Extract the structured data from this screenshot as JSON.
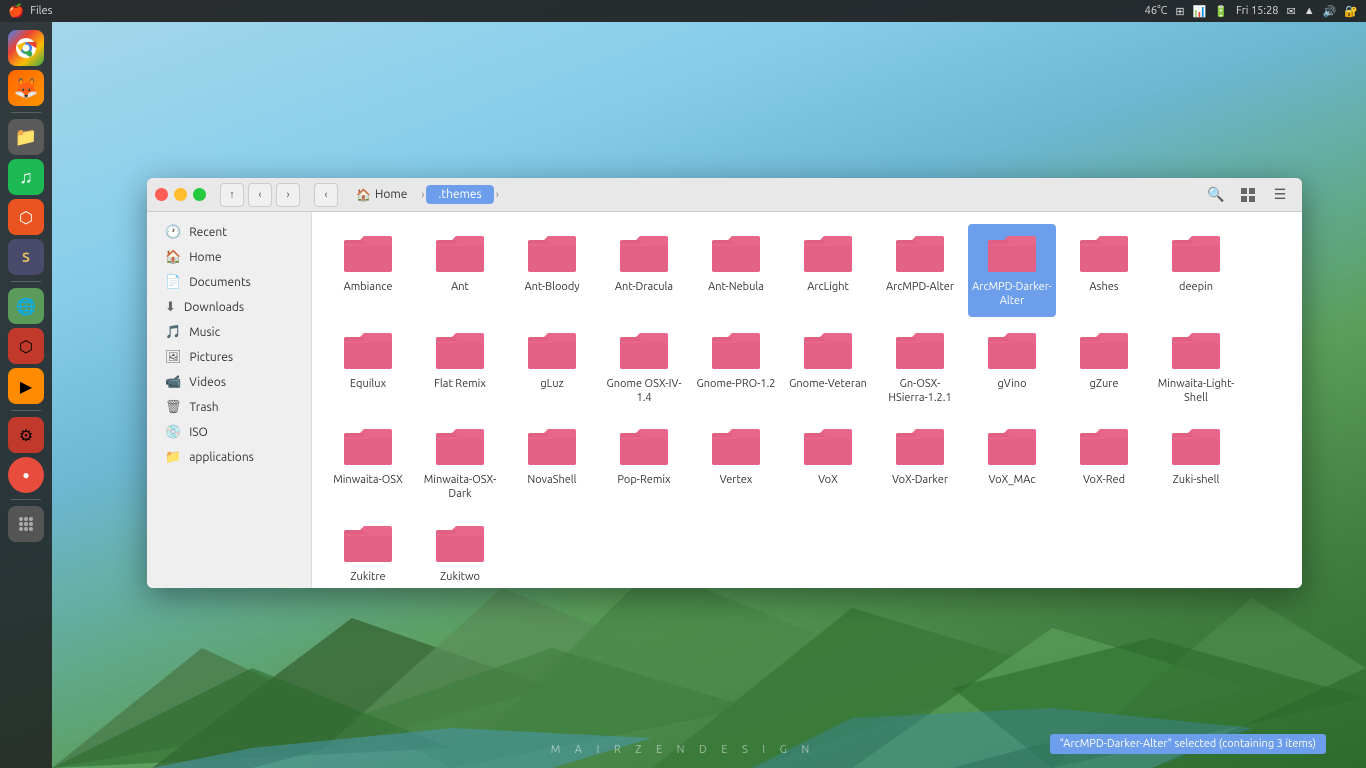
{
  "taskbar": {
    "apple": "🍎",
    "app_name": "Files",
    "system_info": "46°C",
    "datetime": "Fri 15:28",
    "icons": [
      "⊞",
      "📊",
      "🔋",
      "🔊",
      "🔐"
    ]
  },
  "dock": {
    "items": [
      {
        "name": "chrome",
        "label": "Chrome",
        "icon": "●"
      },
      {
        "name": "firefox",
        "label": "Firefox",
        "icon": "●"
      },
      {
        "name": "files",
        "label": "Files",
        "icon": "●"
      },
      {
        "name": "spotify",
        "label": "Spotify",
        "icon": "●"
      },
      {
        "name": "ubuntu",
        "label": "Ubuntu",
        "icon": "●"
      },
      {
        "name": "sublimetext",
        "label": "Sublime Text",
        "icon": "●"
      },
      {
        "name": "vpn",
        "label": "VPN",
        "icon": "●"
      },
      {
        "name": "hexagon",
        "label": "App",
        "icon": "●"
      },
      {
        "name": "vlc",
        "label": "VLC",
        "icon": "●"
      },
      {
        "name": "settings",
        "label": "Settings",
        "icon": "●"
      },
      {
        "name": "dots",
        "label": "App Grid",
        "icon": "●"
      }
    ]
  },
  "window": {
    "title": "Files",
    "breadcrumb": {
      "home_label": "Home",
      "current_label": ".themes",
      "home_icon": "🏠"
    },
    "nav": {
      "back": "‹",
      "forward": "›",
      "up": "↑",
      "down": "↓",
      "search_icon": "🔍",
      "view_icon": "⊞",
      "menu_icon": "☰"
    }
  },
  "sidebar": {
    "items": [
      {
        "name": "recent",
        "label": "Recent",
        "icon": "🕐"
      },
      {
        "name": "home",
        "label": "Home",
        "icon": "🏠"
      },
      {
        "name": "documents",
        "label": "Documents",
        "icon": "📄"
      },
      {
        "name": "downloads",
        "label": "Downloads",
        "icon": "⬇"
      },
      {
        "name": "music",
        "label": "Music",
        "icon": "🎵"
      },
      {
        "name": "pictures",
        "label": "Pictures",
        "icon": "🖼"
      },
      {
        "name": "videos",
        "label": "Videos",
        "icon": "📹"
      },
      {
        "name": "trash",
        "label": "Trash",
        "icon": "🗑"
      },
      {
        "name": "iso",
        "label": "ISO",
        "icon": "💿"
      },
      {
        "name": "applications",
        "label": "applications",
        "icon": "📁"
      }
    ]
  },
  "folders": [
    {
      "name": "Ambiance",
      "selected": false
    },
    {
      "name": "Ant",
      "selected": false
    },
    {
      "name": "Ant-Bloody",
      "selected": false
    },
    {
      "name": "Ant-Dracula",
      "selected": false
    },
    {
      "name": "Ant-Nebula",
      "selected": false
    },
    {
      "name": "ArcLight",
      "selected": false
    },
    {
      "name": "ArcMPD-Alter",
      "selected": false
    },
    {
      "name": "ArcMPD-Darker-Alter",
      "selected": true
    },
    {
      "name": "Ashes",
      "selected": false
    },
    {
      "name": "deepin",
      "selected": false
    },
    {
      "name": "Equilux",
      "selected": false
    },
    {
      "name": "Flat Remix",
      "selected": false
    },
    {
      "name": "gLuz",
      "selected": false
    },
    {
      "name": "Gnome OSX-IV-1.4",
      "selected": false
    },
    {
      "name": "Gnome-PRO-1.2",
      "selected": false
    },
    {
      "name": "Gnome-Veteran",
      "selected": false
    },
    {
      "name": "Gn-OSX-HSierra-1.2.1",
      "selected": false
    },
    {
      "name": "gVino",
      "selected": false
    },
    {
      "name": "gZure",
      "selected": false
    },
    {
      "name": "Minwaita-Light-Shell",
      "selected": false
    },
    {
      "name": "Minwaita-OSX",
      "selected": false
    },
    {
      "name": "Minwaita-OSX-Dark",
      "selected": false
    },
    {
      "name": "NovaShell",
      "selected": false
    },
    {
      "name": "Pop-Remix",
      "selected": false
    },
    {
      "name": "Vertex",
      "selected": false
    },
    {
      "name": "VoX",
      "selected": false
    },
    {
      "name": "VoX-Darker",
      "selected": false
    },
    {
      "name": "VoX_MAc",
      "selected": false
    },
    {
      "name": "VoX-Red",
      "selected": false
    },
    {
      "name": "Zuki-shell",
      "selected": false
    },
    {
      "name": "Zukitre",
      "selected": false
    },
    {
      "name": "Zukitwo",
      "selected": false
    }
  ],
  "status": {
    "tooltip": "\"ArcMPD-Darker-Alter\" selected  (containing 3 items)"
  },
  "watermark": "M A I R Z E N   D E S I G N"
}
